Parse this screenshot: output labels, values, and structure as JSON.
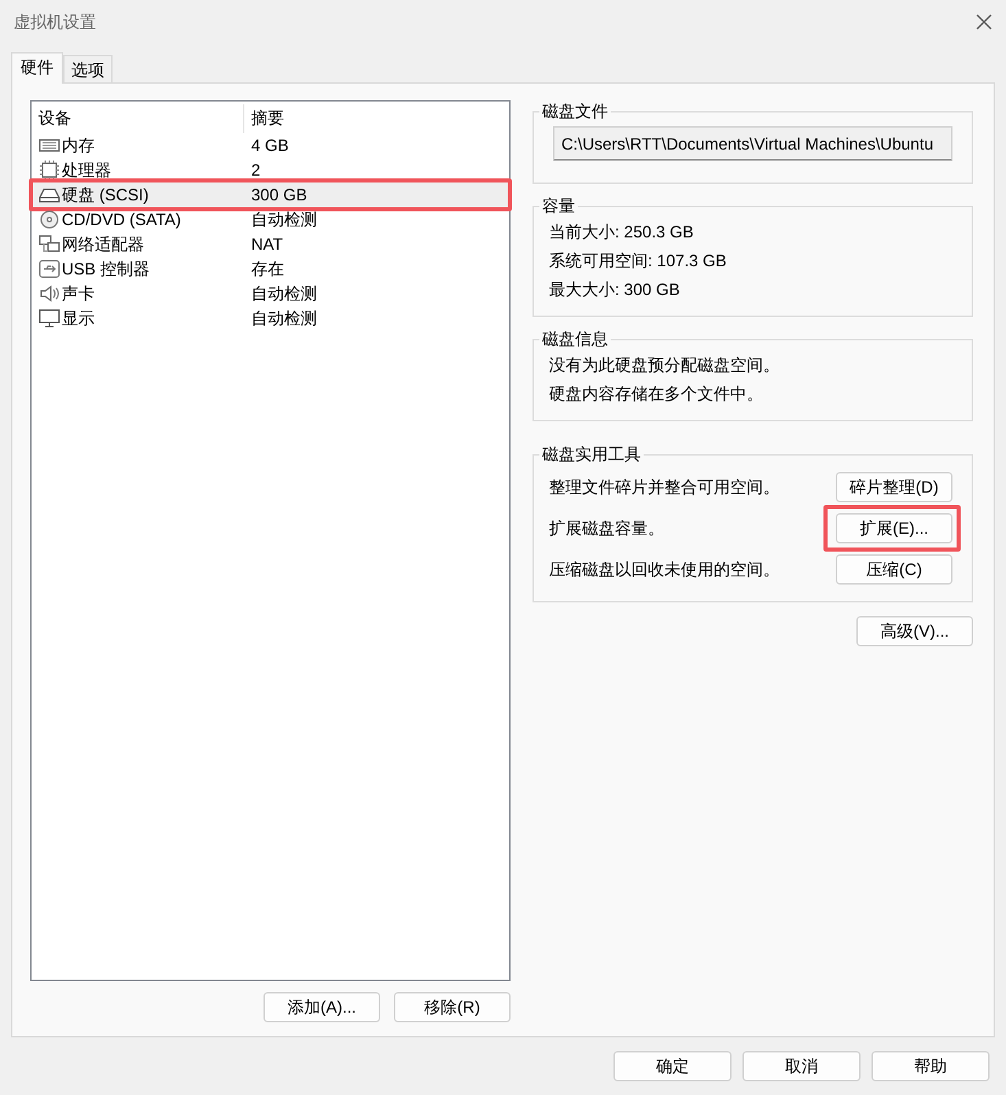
{
  "window": {
    "title": "虚拟机设置"
  },
  "tabs": [
    {
      "label": "硬件",
      "selected": true
    },
    {
      "label": "选项",
      "selected": false
    }
  ],
  "device_table": {
    "columns": [
      "设备",
      "摘要"
    ],
    "rows": [
      {
        "kind": "memory",
        "device": "内存",
        "summary": "4 GB",
        "selected": false,
        "highlighted": false
      },
      {
        "kind": "cpu",
        "device": "处理器",
        "summary": "2",
        "selected": false,
        "highlighted": false
      },
      {
        "kind": "disk",
        "device": "硬盘 (SCSI)",
        "summary": "300 GB",
        "selected": true,
        "highlighted": true
      },
      {
        "kind": "cd",
        "device": "CD/DVD (SATA)",
        "summary": "自动检测",
        "selected": false,
        "highlighted": false
      },
      {
        "kind": "network",
        "device": "网络适配器",
        "summary": "NAT",
        "selected": false,
        "highlighted": false
      },
      {
        "kind": "usb",
        "device": "USB 控制器",
        "summary": "存在",
        "selected": false,
        "highlighted": false
      },
      {
        "kind": "sound",
        "device": "声卡",
        "summary": "自动检测",
        "selected": false,
        "highlighted": false
      },
      {
        "kind": "display",
        "device": "显示",
        "summary": "自动检测",
        "selected": false,
        "highlighted": false
      }
    ]
  },
  "device_buttons": [
    "添加(A)...",
    "移除(R)"
  ],
  "disk_file": {
    "title": "磁盘文件",
    "value": "C:\\Users\\RTT\\Documents\\Virtual Machines\\Ubuntu"
  },
  "capacity": {
    "title": "容量",
    "lines": [
      "当前大小: 250.3 GB",
      "系统可用空间: 107.3 GB",
      "最大大小: 300 GB"
    ]
  },
  "disk_info": {
    "title": "磁盘信息",
    "lines": [
      "没有为此硬盘预分配磁盘空间。",
      "硬盘内容存储在多个文件中。"
    ]
  },
  "disk_utilities": {
    "title": "磁盘实用工具",
    "items": [
      {
        "text": "整理文件碎片并整合可用空间。",
        "button": "碎片整理(D)",
        "highlighted": false
      },
      {
        "text": "扩展磁盘容量。",
        "button": "扩展(E)...",
        "highlighted": true
      },
      {
        "text": "压缩磁盘以回收未使用的空间。",
        "button": "压缩(C)",
        "highlighted": false
      }
    ]
  },
  "advanced_button": "高级(V)...",
  "dialog_buttons": [
    "确定",
    "取消",
    "帮助"
  ]
}
